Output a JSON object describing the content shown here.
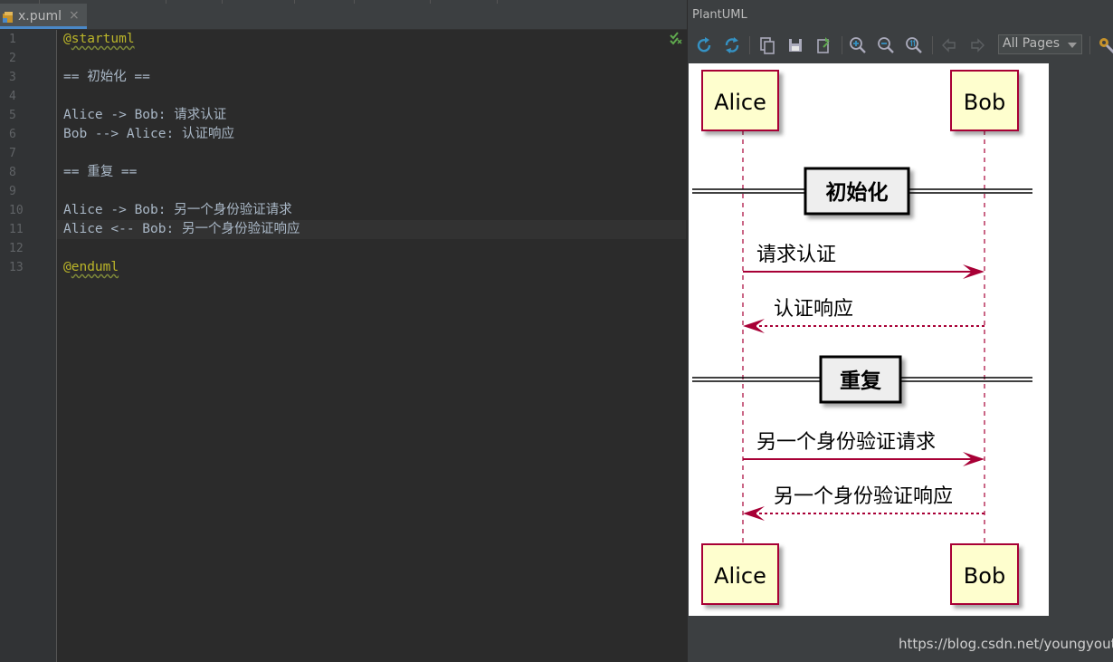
{
  "editor": {
    "tab": {
      "filename": "x.puml",
      "close": "×"
    },
    "lines": [
      {
        "no": "1",
        "parts": [
          {
            "t": "@",
            "c": "at"
          },
          {
            "t": "startuml",
            "c": "kw"
          }
        ]
      },
      {
        "no": "2",
        "parts": []
      },
      {
        "no": "3",
        "parts": [
          {
            "t": "== 初始化 ==",
            "c": ""
          }
        ]
      },
      {
        "no": "4",
        "parts": []
      },
      {
        "no": "5",
        "parts": [
          {
            "t": "Alice -> Bob: 请求认证",
            "c": ""
          }
        ]
      },
      {
        "no": "6",
        "parts": [
          {
            "t": "Bob --> Alice: 认证响应",
            "c": ""
          }
        ]
      },
      {
        "no": "7",
        "parts": []
      },
      {
        "no": "8",
        "parts": [
          {
            "t": "== 重复 ==",
            "c": ""
          }
        ]
      },
      {
        "no": "9",
        "parts": []
      },
      {
        "no": "10",
        "parts": [
          {
            "t": "Alice -> Bob: 另一个身份验证请求",
            "c": ""
          }
        ]
      },
      {
        "no": "11",
        "parts": [
          {
            "t": "Alice <-- Bob: 另一个身份验证响应",
            "c": ""
          }
        ]
      },
      {
        "no": "12",
        "parts": []
      },
      {
        "no": "13",
        "parts": [
          {
            "t": "@",
            "c": "at"
          },
          {
            "t": "enduml",
            "c": "kw"
          }
        ]
      }
    ],
    "current_line": "11",
    "status_icon": "check-icon"
  },
  "panel": {
    "title": "PlantUML",
    "toolbar": {
      "buttons": [
        "refresh-icon",
        "auto-refresh-icon",
        "copy-icon",
        "save-icon",
        "export-icon",
        "zoom-in-icon",
        "zoom-out-icon",
        "actual-size-icon",
        "back-icon",
        "forward-icon",
        "settings-icon"
      ],
      "pages_select": "All Pages"
    }
  },
  "diagram": {
    "participants": [
      "Alice",
      "Bob"
    ],
    "dividers": [
      "初始化",
      "重复"
    ],
    "messages": [
      {
        "from": "Alice",
        "to": "Bob",
        "label": "请求认证",
        "style": "solid"
      },
      {
        "from": "Bob",
        "to": "Alice",
        "label": "认证响应",
        "style": "dashed"
      },
      {
        "from": "Alice",
        "to": "Bob",
        "label": "另一个身份验证请求",
        "style": "solid"
      },
      {
        "from": "Bob",
        "to": "Alice",
        "label": "另一个身份验证响应",
        "style": "dashed"
      }
    ],
    "colors": {
      "participant_fill": "#fefece",
      "participant_border": "#a80036",
      "arrow": "#a80036",
      "divider_fill": "#eeeeee"
    }
  },
  "watermark": "https://blog.csdn.net/youngyouth"
}
